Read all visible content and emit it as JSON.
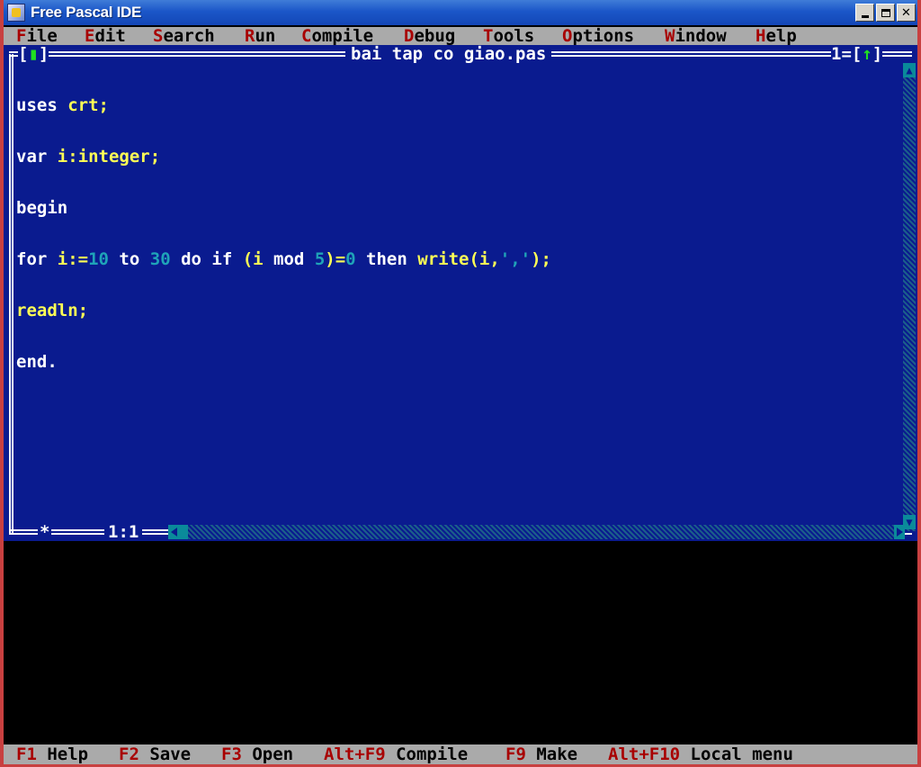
{
  "window": {
    "title": "Free Pascal IDE"
  },
  "menu": [
    {
      "hot": "F",
      "rest": "ile"
    },
    {
      "hot": "E",
      "rest": "dit"
    },
    {
      "hot": "S",
      "rest": "earch"
    },
    {
      "hot": "R",
      "rest": "un"
    },
    {
      "hot": "C",
      "rest": "ompile"
    },
    {
      "hot": "D",
      "rest": "ebug"
    },
    {
      "hot": "T",
      "rest": "ools"
    },
    {
      "hot": "O",
      "rest": "ptions"
    },
    {
      "hot": "W",
      "rest": "indow"
    },
    {
      "hot": "H",
      "rest": "elp"
    }
  ],
  "editor": {
    "file_name": "bai tap co giao.pas",
    "window_number": "1",
    "cursor_position": "1:1",
    "modified_marker": "*",
    "code_lines": [
      "uses crt;",
      "var i:integer;",
      "begin",
      "for i:=10 to 30 do if (i mod 5)=0 then write(i,',');",
      "readln;",
      "end."
    ]
  },
  "statusbar": [
    {
      "key": "F1",
      "label": "Help"
    },
    {
      "key": "F2",
      "label": "Save"
    },
    {
      "key": "F3",
      "label": "Open"
    },
    {
      "key": "Alt+F9",
      "label": "Compile"
    },
    {
      "key": "F9",
      "label": "Make"
    },
    {
      "key": "Alt+F10",
      "label": "Local menu"
    }
  ],
  "colors": {
    "editor_background": "#0a1b8f",
    "menu_background": "#aaaaaa",
    "hotkey": "#a80000",
    "identifier": "#ffff55",
    "literal": "#1fa3b8"
  }
}
